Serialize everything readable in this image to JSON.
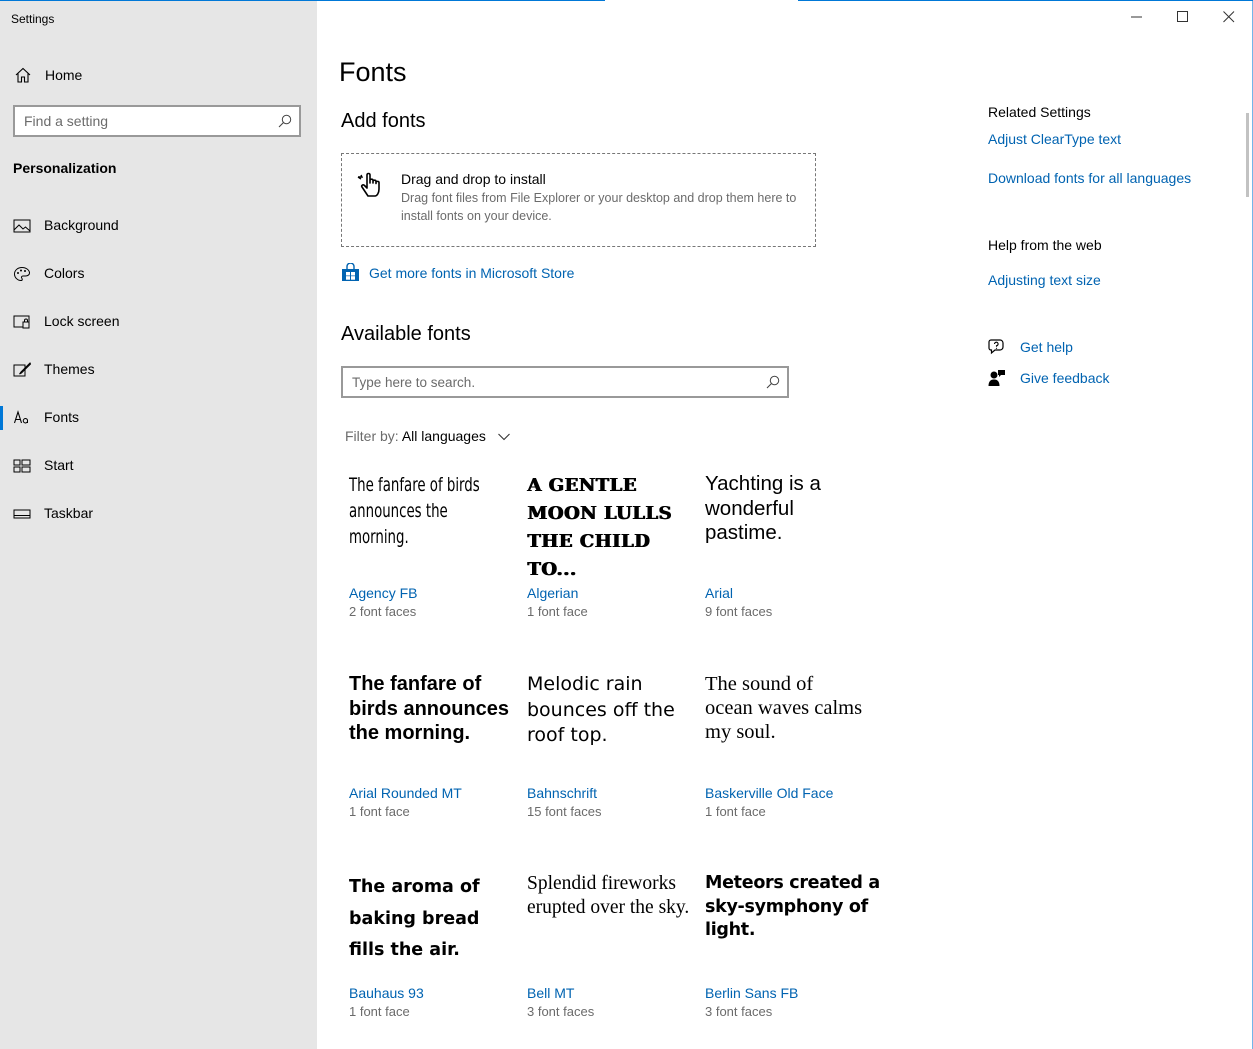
{
  "window": {
    "title": "Settings",
    "accent": "#0078d7",
    "link_color": "#0063b1"
  },
  "sidebar": {
    "home_label": "Home",
    "home_icon": "home-icon",
    "search_placeholder": "Find a setting",
    "section_title": "Personalization",
    "items": [
      {
        "label": "Background",
        "icon": "picture-icon",
        "active": false
      },
      {
        "label": "Colors",
        "icon": "palette-icon",
        "active": false
      },
      {
        "label": "Lock screen",
        "icon": "lock-screen-icon",
        "active": false
      },
      {
        "label": "Themes",
        "icon": "brush-icon",
        "active": false
      },
      {
        "label": "Fonts",
        "icon": "font-icon",
        "active": true
      },
      {
        "label": "Start",
        "icon": "start-icon",
        "active": false
      },
      {
        "label": "Taskbar",
        "icon": "taskbar-icon",
        "active": false
      }
    ]
  },
  "main": {
    "page_title": "Fonts",
    "add_fonts_heading": "Add fonts",
    "drop_zone": {
      "title": "Drag and drop to install",
      "description": "Drag font files from File Explorer or your desktop and drop them here to install fonts on your device."
    },
    "store_link": "Get more fonts in Microsoft Store",
    "available_heading": "Available fonts",
    "font_search_placeholder": "Type here to search.",
    "filter": {
      "label": "Filter by:",
      "value": "All languages"
    },
    "fonts": [
      {
        "sample": "The fanfare of birds announces the morning.",
        "name": "Agency FB",
        "faces": "2 font faces"
      },
      {
        "sample": "A GENTLE MOON LULLS THE CHILD TO...",
        "name": "Algerian",
        "faces": "1 font face"
      },
      {
        "sample": "Yachting is a wonderful pastime.",
        "name": "Arial",
        "faces": "9 font faces"
      },
      {
        "sample": "The fanfare of birds announces the morning.",
        "name": "Arial Rounded MT",
        "faces": "1 font face"
      },
      {
        "sample": "Melodic rain bounces off the roof top.",
        "name": "Bahnschrift",
        "faces": "15 font faces"
      },
      {
        "sample": "The sound of ocean waves calms my soul.",
        "name": "Baskerville Old Face",
        "faces": "1 font face"
      },
      {
        "sample": "The aroma of baking bread fills the air.",
        "name": "Bauhaus 93",
        "faces": "1 font face"
      },
      {
        "sample": "Splendid fireworks erupted over the sky.",
        "name": "Bell MT",
        "faces": "3 font faces"
      },
      {
        "sample": "Meteors created a sky-symphony of light.",
        "name": "Berlin Sans FB",
        "faces": "3 font faces"
      }
    ]
  },
  "related": {
    "title": "Related Settings",
    "links": [
      "Adjust ClearType text",
      "Download fonts for all languages"
    ],
    "help_title": "Help from the web",
    "help_links": [
      "Adjusting text size"
    ],
    "get_help": "Get help",
    "give_feedback": "Give feedback"
  }
}
